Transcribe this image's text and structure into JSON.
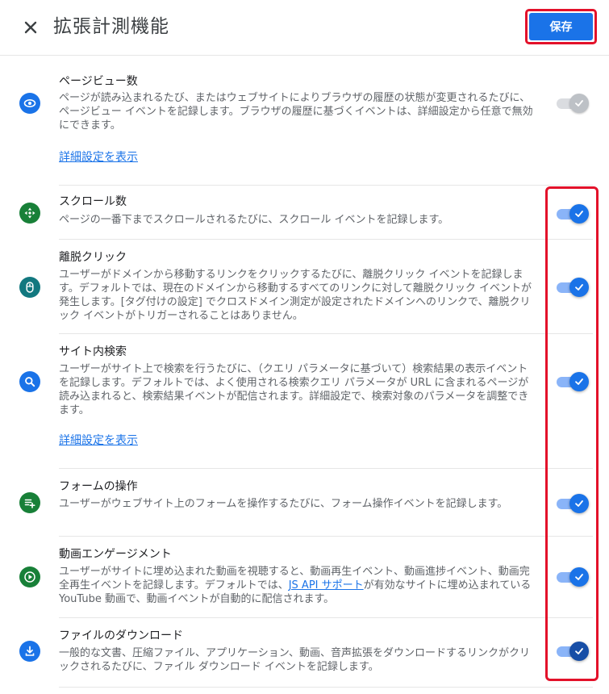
{
  "header": {
    "close_icon": "close-icon",
    "title": "拡張計測機能",
    "save_label": "保存"
  },
  "colors": {
    "accent": "#1a73e8",
    "highlight": "#e3112a",
    "green_icon": "#188038",
    "teal_icon": "#12787f"
  },
  "events": [
    {
      "title": "ページビュー数",
      "description": "ページが読み込まれるたび、またはウェブサイトによりブラウザの履歴の状態が変更されるたびに、ページビュー イベントを記録します。ブラウザの履歴に基づくイベントは、詳細設定から任意で無効にできます。",
      "link": "詳細設定を表示",
      "icon": "eye-icon",
      "toggle": "on-disabled"
    },
    {
      "title": "スクロール数",
      "description": "ページの一番下までスクロールされるたびに、スクロール イベントを記録します。",
      "icon": "scroll-arrows-icon",
      "toggle": "on"
    },
    {
      "title": "離脱クリック",
      "description": "ユーザーがドメインから移動するリンクをクリックするたびに、離脱クリック イベントを記録します。デフォルトでは、現在のドメインから移動するすべてのリンクに対して離脱クリック イベントが発生します。[タグ付けの設定] でクロスドメイン測定が設定されたドメインへのリンクで、離脱クリック イベントがトリガーされることはありません。",
      "icon": "mouse-icon",
      "toggle": "on"
    },
    {
      "title": "サイト内検索",
      "description": "ユーザーがサイト上で検索を行うたびに、（クエリ パラメータに基づいて）検索結果の表示イベントを記録します。デフォルトでは、よく使用される検索クエリ パラメータが URL に含まれるページが読み込まれると、検索結果イベントが配信されます。詳細設定で、検索対象のパラメータを調整できます。",
      "link": "詳細設定を表示",
      "icon": "search-icon",
      "toggle": "on"
    },
    {
      "title": "フォームの操作",
      "description": "ユーザーがウェブサイト上のフォームを操作するたびに、フォーム操作イベントを記録します。",
      "icon": "form-add-icon",
      "toggle": "on"
    },
    {
      "title": "動画エンゲージメント",
      "description_before": "ユーザーがサイトに埋め込まれた動画を視聴すると、動画再生イベント、動画進捗イベント、動画完全再生イベントを記録します。デフォルトでは、",
      "description_link": "JS API サポート",
      "description_after": "が有効なサイトに埋め込まれている YouTube 動画で、動画イベントが自動的に配信されます。",
      "icon": "play-icon",
      "toggle": "on"
    },
    {
      "title": "ファイルのダウンロード",
      "description": "一般的な文書、圧縮ファイル、アプリケーション、動画、音声拡張をダウンロードするリンクがクリックされるたびに、ファイル ダウンロード イベントを記録します。",
      "icon": "download-icon",
      "toggle": "on-focused"
    }
  ]
}
